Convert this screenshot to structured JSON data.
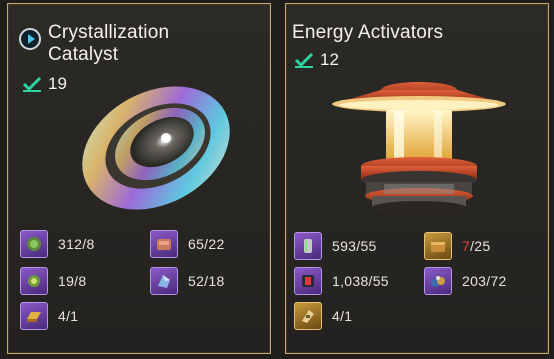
{
  "cards": [
    {
      "title_line1": "Crystallization",
      "title_line2": "Catalyst",
      "owned": "19",
      "requirements": [
        {
          "icon": "green-orb-icon",
          "qty": "312/8"
        },
        {
          "icon": "ore-chunk-icon",
          "qty": "65/22"
        },
        {
          "icon": "green-orb-small-icon",
          "qty": "19/8"
        },
        {
          "icon": "crystal-shard-icon",
          "qty": "52/18"
        },
        {
          "icon": "gold-bar-icon",
          "qty": "4/1"
        }
      ]
    },
    {
      "title_line1": "Energy Activators",
      "owned": "12",
      "requirements": [
        {
          "icon": "canister-icon",
          "qty": "593/55"
        },
        {
          "icon": "supply-crate-icon",
          "qty_short": "7",
          "qty_rest": "/25"
        },
        {
          "icon": "red-core-icon",
          "qty": "1,038/55"
        },
        {
          "icon": "scrap-pile-icon",
          "qty": "203/72"
        },
        {
          "icon": "gold-part-icon",
          "qty": "4/1"
        }
      ]
    }
  ],
  "colors": {
    "border": "#c8a96a",
    "check": "#2fd3a0",
    "purple_slot": "#6a3fa4",
    "gold_slot": "#b88a30",
    "short_qty": "#e0443a"
  }
}
